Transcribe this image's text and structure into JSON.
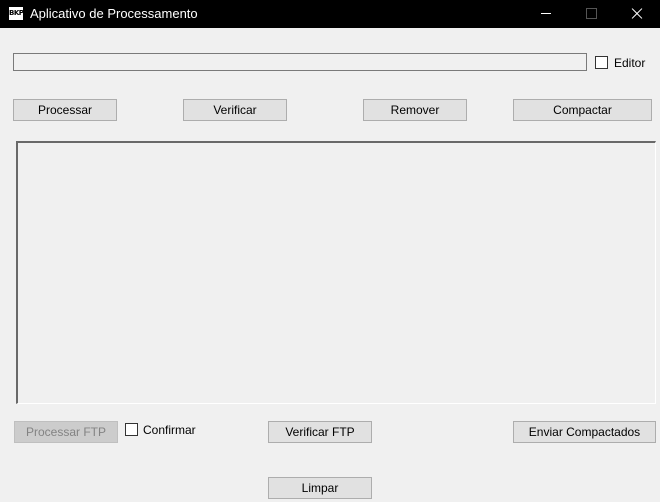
{
  "window": {
    "icon": "app-logo-icon",
    "icon_text": "BKP",
    "title": "Aplicativo de Processamento",
    "controls": [
      "minimize-icon",
      "maximize-icon",
      "close-icon"
    ]
  },
  "path_field": {
    "value": "",
    "placeholder": ""
  },
  "editor_checkbox": {
    "label": "Editor",
    "checked": false
  },
  "actions": {
    "processar": "Processar",
    "verificar": "Verificar",
    "remover": "Remover",
    "compactar": "Compactar"
  },
  "output": {
    "text": ""
  },
  "ftp": {
    "processar_ftp": "Processar FTP",
    "processar_ftp_enabled": false,
    "confirmar_label": "Confirmar",
    "confirmar_checked": false,
    "verificar_ftp": "Verificar FTP",
    "enviar_compactados": "Enviar Compactados"
  },
  "limpar": "Limpar"
}
